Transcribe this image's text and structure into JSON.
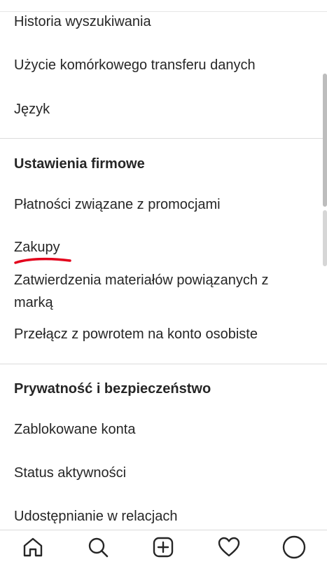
{
  "menu": {
    "items_top": [
      {
        "label": "Historia wyszukiwania"
      },
      {
        "label": "Użycie komórkowego transferu danych"
      },
      {
        "label": "Język"
      }
    ],
    "business": {
      "title": "Ustawienia firmowe",
      "items": [
        {
          "label": "Płatności związane z promocjami"
        },
        {
          "label": "Zakupy"
        },
        {
          "label": "Zatwierdzenia materiałów powiązanych z marką"
        },
        {
          "label": "Przełącz z powrotem na konto osobiste"
        }
      ]
    },
    "privacy": {
      "title": "Prywatność i bezpieczeństwo",
      "items": [
        {
          "label": "Zablokowane konta"
        },
        {
          "label": "Status aktywności"
        },
        {
          "label": "Udostępnianie w relacjach"
        }
      ]
    }
  },
  "bottom_nav": [
    {
      "icon": "home-icon"
    },
    {
      "icon": "search-icon"
    },
    {
      "icon": "add-post-icon"
    },
    {
      "icon": "heart-icon"
    },
    {
      "icon": "profile-icon"
    }
  ],
  "colors": {
    "text": "#262626",
    "divider": "#dbdbdb",
    "annotation_red": "#e3001b"
  }
}
